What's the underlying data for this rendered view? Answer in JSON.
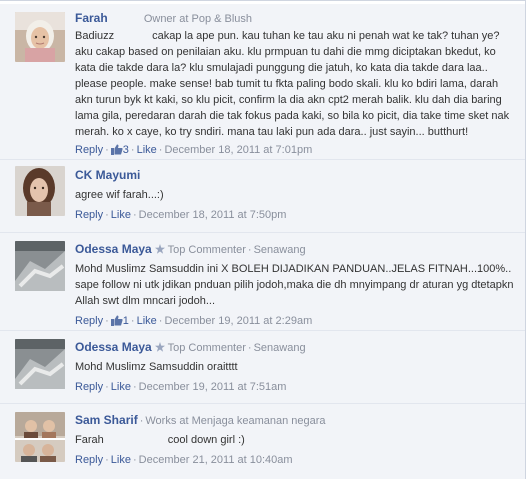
{
  "comments": [
    {
      "author": "Farah",
      "meta": "Owner at Pop & Blush",
      "text_lead": "Badiuzz",
      "text": "cakap la ape pun. kau tuhan ke tau aku ni penah wat ke tak? tuhan ye? aku cakap based on penilaian aku. klu prmpuan tu dahi die mmg diciptakan bkedut, ko kata die takde dara la? klu smulajadi punggung die jatuh, ko kata dia takde dara laa.. please people. make sense! bab tumit tu fkta paling bodo skali. klu ko bdiri lama, darah akn turun byk kt kaki, so klu picit, confirm la dia akn cpt2 merah balik. klu dah dia baring lama gila, peredaran darah die tak fokus pada kaki, so bila ko picit, dia take time sket nak merah. ko x caye, ko try sndiri. mana tau laki pun ada dara.. just sayin... butthurt!",
      "reply": "Reply",
      "likes": "3",
      "like": "Like",
      "date": "December 18, 2011 at 7:01pm"
    },
    {
      "author": "CK Mayumi",
      "text": "agree wif farah...:)",
      "reply": "Reply",
      "like": "Like",
      "date": "December 18, 2011 at 7:50pm"
    },
    {
      "author": "Odessa Maya",
      "meta_badge": "Top Commenter",
      "meta_loc": "Senawang",
      "text": "Mohd Muslimz Samsuddin ini X BOLEH DIJADIKAN PANDUAN..JELAS FITNAH...100%.. sape follow ni utk jdikan pnduan pilih jodoh,maka die dh mnyimpang dr aturan yg dtetapkn Allah swt dlm mncari jodoh...",
      "reply": "Reply",
      "likes": "1",
      "like": "Like",
      "date": "December 19, 2011 at 2:29am"
    },
    {
      "author": "Odessa Maya",
      "meta_badge": "Top Commenter",
      "meta_loc": "Senawang",
      "text": "Mohd Muslimz Samsuddin oraitttt",
      "reply": "Reply",
      "like": "Like",
      "date": "December 19, 2011 at 7:51am"
    },
    {
      "author": "Sam Sharif",
      "meta": "Works at Menjaga keamanan negara",
      "text_lead": "Farah",
      "text": "cool down girl :)",
      "reply": "Reply",
      "like": "Like",
      "date": "December 21, 2011 at 10:40am"
    }
  ],
  "colors": {
    "link": "#3b5998",
    "meta": "#898f9c",
    "text": "#333333",
    "background": "#f2f4f8"
  },
  "icons": {
    "like": "thumbs-up-icon",
    "badge": "star-icon"
  }
}
